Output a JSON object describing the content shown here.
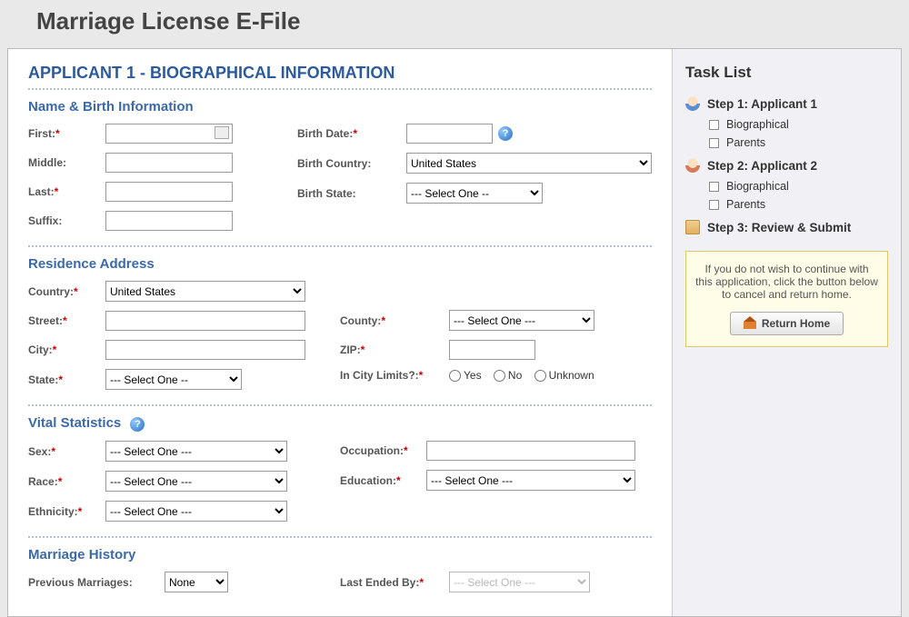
{
  "header": {
    "title": "Marriage License E-File"
  },
  "main": {
    "title": "APPLICANT 1 - BIOGRAPHICAL INFORMATION",
    "nameBirth": {
      "heading": "Name & Birth Information",
      "first": "First:",
      "middle": "Middle:",
      "last": "Last:",
      "suffix": "Suffix:",
      "birthDate": "Birth Date:",
      "birthCountry": "Birth Country:",
      "birthCountryValue": "United States",
      "birthState": "Birth State:",
      "birthStateValue": "--- Select One --"
    },
    "residence": {
      "heading": "Residence Address",
      "country": "Country:",
      "countryValue": "United States",
      "street": "Street:",
      "city": "City:",
      "state": "State:",
      "stateValue": "--- Select One --",
      "county": "County:",
      "countyValue": "--- Select One ---",
      "zip": "ZIP:",
      "inCity": "In City Limits?:",
      "yes": "Yes",
      "no": "No",
      "unknown": "Unknown"
    },
    "vital": {
      "heading": "Vital Statistics",
      "sex": "Sex:",
      "race": "Race:",
      "ethnicity": "Ethnicity:",
      "selectOne": "--- Select One ---",
      "occupation": "Occupation:",
      "education": "Education:",
      "educationValue": "--- Select One ---"
    },
    "marriage": {
      "heading": "Marriage History",
      "previous": "Previous Marriages:",
      "previousValue": "None",
      "lastEnded": "Last Ended By:",
      "lastEndedValue": "--- Select One ---"
    }
  },
  "sidebar": {
    "title": "Task List",
    "step1": "Step 1: Applicant 1",
    "step2": "Step 2: Applicant 2",
    "step3": "Step 3: Review & Submit",
    "biographical": "Biographical",
    "parents": "Parents",
    "notice": "If you do not wish to continue with this application, click the button below to cancel and return home.",
    "returnHome": "Return Home"
  }
}
